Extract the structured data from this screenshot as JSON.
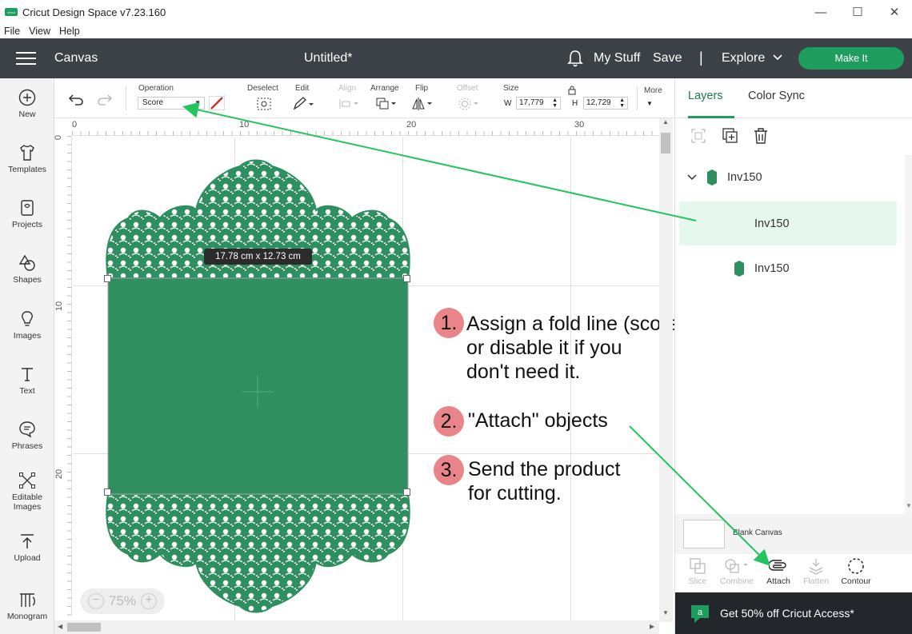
{
  "window": {
    "title": "Cricut Design Space  v7.23.160",
    "logo_text": "cricut",
    "minimize": "—",
    "maximize": "☐",
    "close": "✕"
  },
  "menu": [
    "File",
    "View",
    "Help"
  ],
  "header": {
    "section": "Canvas",
    "document": "Untitled*",
    "my_stuff": "My Stuff",
    "save": "Save",
    "separator": "|",
    "explore": "Explore",
    "make_it": "Make It",
    "accent": "#1d9e5f",
    "bar_color": "#3c4147"
  },
  "sidebar": [
    {
      "label": "New",
      "icon": "plus-circle-icon"
    },
    {
      "label": "Templates",
      "icon": "shirt-icon"
    },
    {
      "label": "Projects",
      "icon": "bookmark-icon"
    },
    {
      "label": "Shapes",
      "icon": "shapes-icon"
    },
    {
      "label": "Images",
      "icon": "lightbulb-icon"
    },
    {
      "label": "Text",
      "icon": "text-icon"
    },
    {
      "label": "Phrases",
      "icon": "speech-bubble-icon"
    },
    {
      "label": "Editable Images",
      "icon": "editable-image-icon"
    },
    {
      "label": "Upload",
      "icon": "upload-icon"
    },
    {
      "label": "Monogram",
      "icon": "monogram-icon"
    }
  ],
  "toolbar": {
    "operation_label": "Operation",
    "operation_value": "Score",
    "deselect": "Deselect",
    "edit": "Edit",
    "align": "Align",
    "arrange": "Arrange",
    "flip": "Flip",
    "offset": "Offset",
    "size": "Size",
    "w_label": "W",
    "w_value": "17,779",
    "h_label": "H",
    "h_value": "12,729",
    "more": "More"
  },
  "canvas": {
    "ruler_h": [
      "0",
      "10",
      "20",
      "30"
    ],
    "ruler_v": [
      "0",
      "10",
      "20"
    ],
    "dimension_tag": "17.78  cm x 12.73  cm",
    "zoom": "75%",
    "zoom_minus": "−",
    "zoom_plus": "+",
    "shape_color": "#2f8f5e"
  },
  "instructions": [
    {
      "num": "1.",
      "text": "Assign a fold line (score)\nor disable it if you\ndon't need it."
    },
    {
      "num": "2.",
      "text": "\"Attach\" objects"
    },
    {
      "num": "3.",
      "text": "Send the product\nfor cutting."
    }
  ],
  "right_panel": {
    "tabs": [
      "Layers",
      "Color Sync"
    ],
    "layers": [
      {
        "name": "Inv150",
        "type": "group"
      },
      {
        "name": "Inv150",
        "type": "child-selected"
      },
      {
        "name": "Inv150",
        "type": "child"
      }
    ],
    "blank_canvas": "Blank Canvas",
    "bottom_tools": [
      {
        "label": "Slice",
        "enabled": false
      },
      {
        "label": "Combine",
        "enabled": false
      },
      {
        "label": "Attach",
        "enabled": true
      },
      {
        "label": "Flatten",
        "enabled": false
      },
      {
        "label": "Contour",
        "enabled": true
      }
    ],
    "promo": "Get 50% off Cricut Access*"
  },
  "annotation_color": "#22c55e"
}
